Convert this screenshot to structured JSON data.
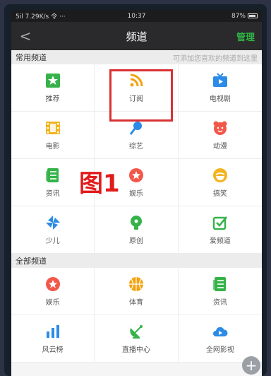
{
  "status_bar": {
    "left": "5il 7.29K/s 令 ···",
    "time": "10:37",
    "battery": "87%"
  },
  "nav": {
    "title": "频道",
    "back": "<",
    "manage": "管理"
  },
  "sections": {
    "common": {
      "title": "常用频道",
      "hint": "可添加您喜欢的频道到这里"
    },
    "all": {
      "title": "全部频道"
    }
  },
  "common_channels": [
    {
      "label": "推荐",
      "icon": "star-square-icon",
      "color": "#35b34a"
    },
    {
      "label": "订阅",
      "icon": "rss-icon",
      "color": "#f3a20f"
    },
    {
      "label": "电视剧",
      "icon": "tv-icon",
      "color": "#2b8be6"
    },
    {
      "label": "电影",
      "icon": "film-icon",
      "color": "#f2b420"
    },
    {
      "label": "综艺",
      "icon": "microphone-icon",
      "color": "#2b8be6"
    },
    {
      "label": "动漫",
      "icon": "cartoon-face-icon",
      "color": "#f2584a"
    },
    {
      "label": "资讯",
      "icon": "news-icon",
      "color": "#35b34a"
    },
    {
      "label": "娱乐",
      "icon": "star-circle-icon",
      "color": "#f2584a"
    },
    {
      "label": "搞笑",
      "icon": "smile-icon",
      "color": "#f2b420"
    },
    {
      "label": "少儿",
      "icon": "pinwheel-icon",
      "color": "#2b8be6"
    },
    {
      "label": "原创",
      "icon": "bulb-icon",
      "color": "#35b34a"
    },
    {
      "label": "爱频道",
      "icon": "checkbox-icon",
      "color": "#35b34a"
    }
  ],
  "all_channels": [
    {
      "label": "娱乐",
      "icon": "star-circle-icon",
      "color": "#f2584a"
    },
    {
      "label": "体育",
      "icon": "basketball-icon",
      "color": "#f3a20f"
    },
    {
      "label": "资讯",
      "icon": "news-icon",
      "color": "#35b34a"
    },
    {
      "label": "风云榜",
      "icon": "bar-chart-icon",
      "color": "#2b8be6"
    },
    {
      "label": "直播中心",
      "icon": "satellite-icon",
      "color": "#35b34a"
    },
    {
      "label": "全网影视",
      "icon": "cloud-icon",
      "color": "#2b8be6"
    }
  ],
  "annotation": {
    "figure_label": "图1",
    "highlight_color": "#d93131"
  },
  "fab": {
    "symbol": "+"
  }
}
